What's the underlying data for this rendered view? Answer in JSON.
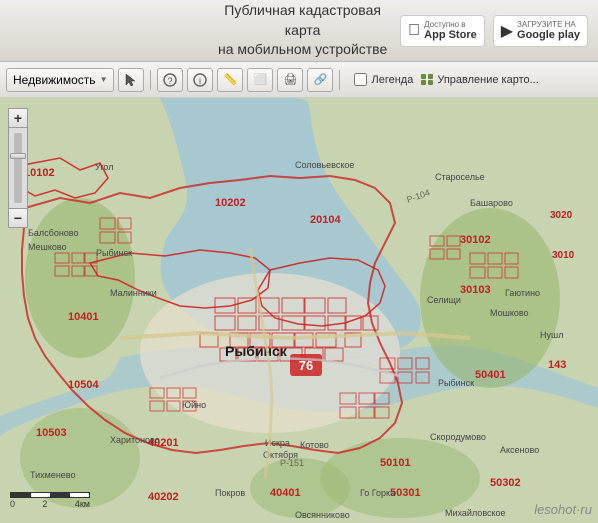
{
  "header": {
    "title_line1": "Публичная кадастровая карта",
    "title_line2": "на мобильном устройстве",
    "appstore_label": "Доступно в",
    "appstore_name": "App Store",
    "googleplay_label": "ЗАГРУЗИТЕ НА",
    "googleplay_name": "Google play"
  },
  "toolbar": {
    "property_label": "Недвижимость",
    "legend_label": "Легенда",
    "manage_label": "Управление карто..."
  },
  "map": {
    "city_label": "Рыбинск",
    "region_code": "76",
    "district_codes": [
      "10102",
      "10202",
      "20104",
      "30102",
      "30103",
      "3020",
      "3010",
      "10401",
      "10504",
      "10503",
      "40201",
      "40202",
      "40401",
      "50101",
      "50301",
      "50302",
      "50401",
      "143"
    ],
    "place_names": [
      "Угол",
      "Соловьевское",
      "Старосельe",
      "Башарово",
      "Балсбоново",
      "Мешково",
      "Рыбинск",
      "Малинники",
      "Рыбинск",
      "Селищи",
      "Гаютино",
      "Мошково",
      "Нушл",
      "Юйно",
      "Харитоново",
      "Искра",
      "Октября",
      "Котово",
      "Скородумово",
      "Михайловское",
      "Овсянниково",
      "Аксеново",
      "Рыбинск",
      "Тихменево",
      "Покров",
      "Го Горка"
    ],
    "road_labels": [
      "Р-104",
      "Р-151"
    ],
    "scalebar": {
      "labels": [
        "0",
        "2",
        "4км"
      ]
    }
  },
  "watermark": "lesohot·ru"
}
